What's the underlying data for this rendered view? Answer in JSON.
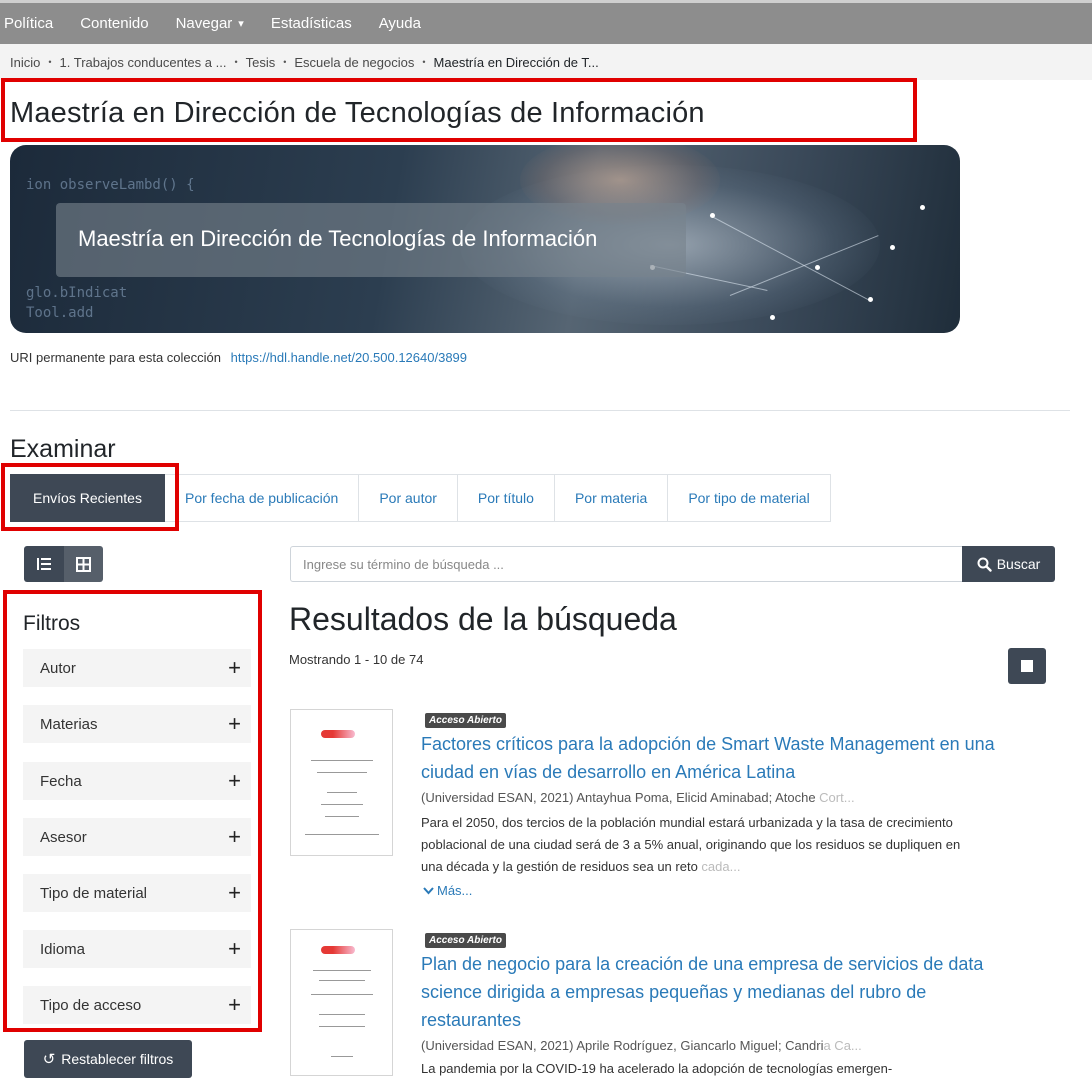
{
  "nav": {
    "items": [
      "Política",
      "Contenido",
      "Navegar",
      "Estadísticas",
      "Ayuda"
    ],
    "dropdown_caret": "▾"
  },
  "breadcrumb": {
    "items": [
      "Inicio",
      "1. Trabajos conducentes a ...",
      "Tesis",
      "Escuela de negocios",
      "Maestría en Dirección de T..."
    ],
    "separator": "•"
  },
  "collection": {
    "title": "Maestría en Dirección de Tecnologías de Información",
    "banner_caption": "Maestría en Dirección de Tecnologías de Información",
    "banner_code_1": "ion observeLambd() {",
    "banner_code_2": "glo.bIndicat",
    "banner_code_3": "Tool.add",
    "uri_label": "URI permanente para esta colección",
    "uri_value": "https://hdl.handle.net/20.500.12640/3899"
  },
  "browse": {
    "title": "Examinar",
    "tabs": [
      "Envíos Recientes",
      "Por fecha de publicación",
      "Por autor",
      "Por título",
      "Por materia",
      "Por tipo de material"
    ],
    "active_tab": "Envíos Recientes"
  },
  "filters": {
    "title": "Filtros",
    "items": [
      "Autor",
      "Materias",
      "Fecha",
      "Asesor",
      "Tipo de material",
      "Idioma",
      "Tipo de acceso"
    ],
    "expand_glyph": "+",
    "reset_label": "Restablecer filtros",
    "reset_icon": "↺"
  },
  "search": {
    "placeholder": "Ingrese su término de búsqueda ...",
    "button_label": "Buscar"
  },
  "results": {
    "title": "Resultados de la búsqueda",
    "count_text": "Mostrando 1 - 10 de 74",
    "items": [
      {
        "badge": "Acceso Abierto",
        "title": "Factores críticos para la adopción de Smart Waste Management en una ciudad en vías de desarrollo en América Latina",
        "meta": "(Universidad ESAN, 2021) Antayhua Poma, Elicid Aminabad; Atoche ",
        "meta_fade": "Cort...",
        "abstract": "Para el 2050, dos tercios de la población mundial estará urbanizada y la tasa de crecimiento poblacional de una ciudad será de 3 a 5% anual, originando que los residuos se dupliquen en una década y la gestión de residuos sea un reto ",
        "abstract_fade": "cada...",
        "more": "Más..."
      },
      {
        "badge": "Acceso Abierto",
        "title": "Plan de negocio para la creación de una empresa de servicios de data science dirigida a empresas pequeñas y medianas del rubro de restaurantes",
        "meta": "(Universidad ESAN, 2021) Aprile Rodríguez, Giancarlo Miguel; Candri",
        "meta_fade": "a Ca...",
        "abstract": "La pandemia por la COVID-19 ha acelerado la adopción de tecnologías emergen-",
        "abstract_fade": ""
      }
    ]
  },
  "colors": {
    "highlight": "#e00000",
    "dark_button": "#3e4855",
    "link": "#2a7ab8",
    "nav_bg": "#8d8d8d"
  }
}
